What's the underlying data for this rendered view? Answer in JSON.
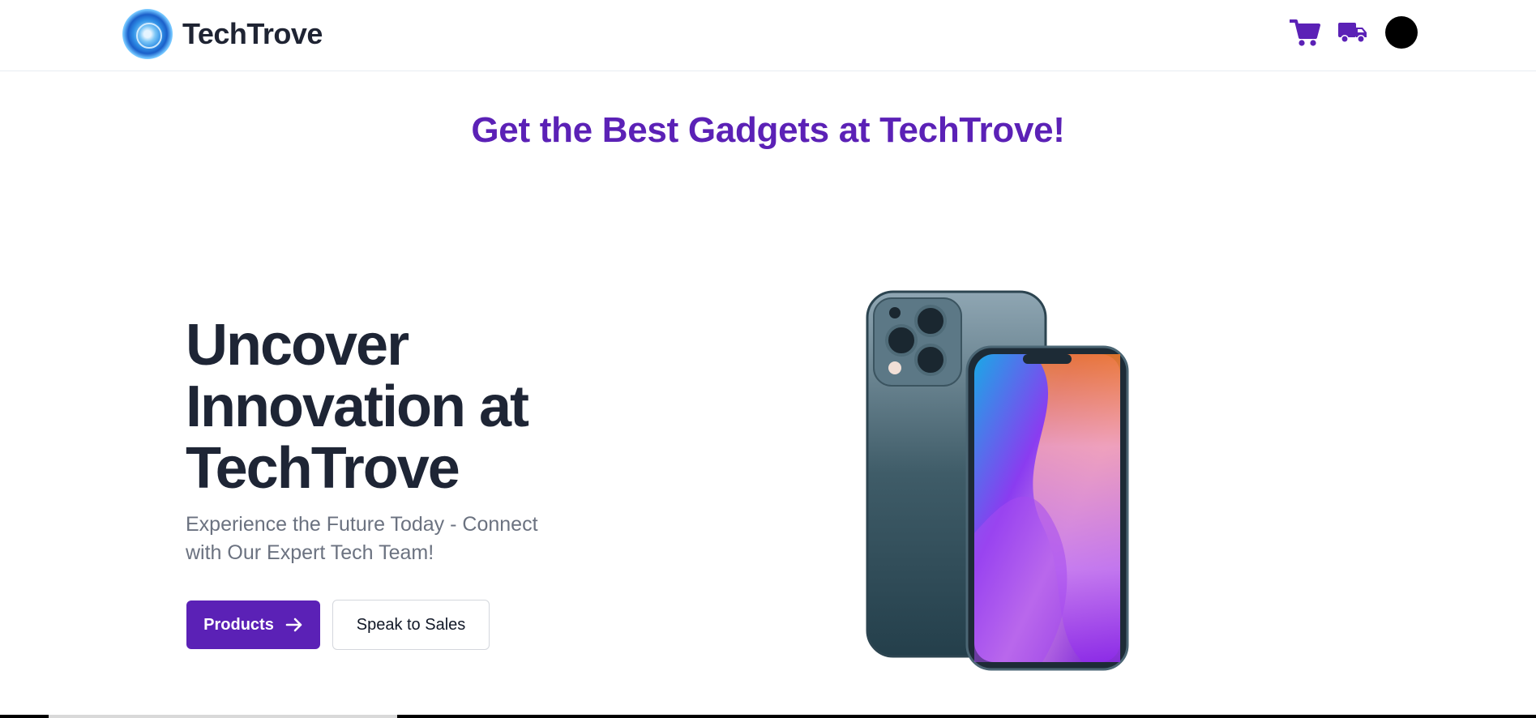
{
  "header": {
    "brand_name": "TechTrove",
    "icons": [
      "cart-icon",
      "truck-icon",
      "avatar"
    ]
  },
  "banner": {
    "text": "Get the Best Gadgets at TechTrove!"
  },
  "hero": {
    "title_lines": [
      "Uncover",
      "Innovation at",
      "TechTrove"
    ],
    "subtitle_lines": [
      "Experience the Future Today - Connect",
      "with Our Expert Tech Team!"
    ],
    "primary_button": "Products",
    "secondary_button": "Speak to Sales"
  },
  "colors": {
    "accent": "#5b21b6",
    "heading": "#1e2535",
    "muted": "#6b7280"
  }
}
